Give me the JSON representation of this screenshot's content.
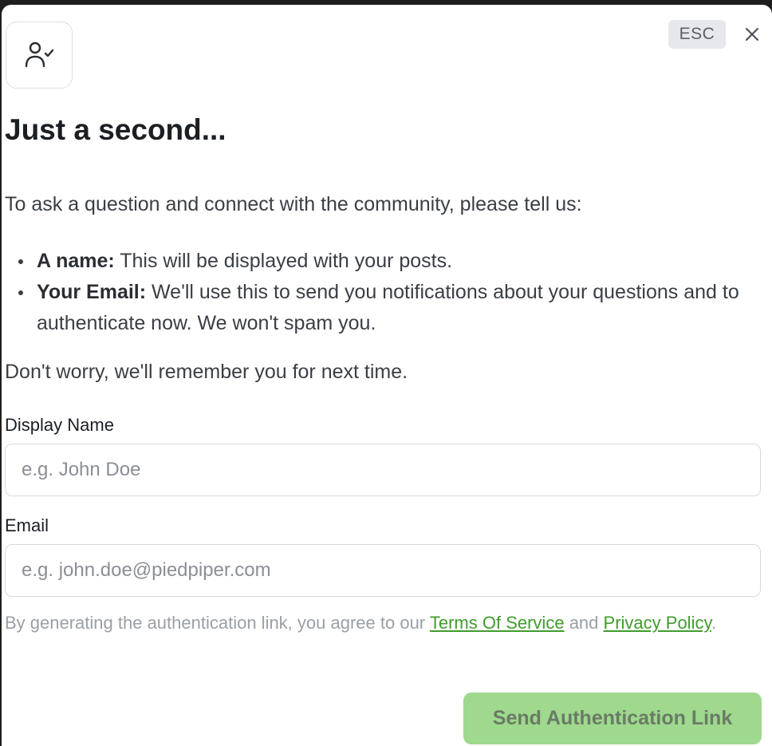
{
  "dialog": {
    "icon": "user-check-icon",
    "esc_label": "ESC",
    "close_icon": "close-icon",
    "title": "Just a second...",
    "intro": "To ask a question and connect with the community, please tell us:",
    "bullets": [
      {
        "label": "A name:",
        "text": "This will be displayed with your posts."
      },
      {
        "label": "Your Email:",
        "text": "We'll use this to send you notifications about your questions and to authenticate now. We won't spam you."
      }
    ],
    "reassurance": "Don't worry, we'll remember you for next time."
  },
  "form": {
    "name_label": "Display Name",
    "name_placeholder": "e.g. John Doe",
    "name_value": "",
    "email_label": "Email",
    "email_placeholder": "e.g. john.doe@piedpiper.com",
    "email_value": ""
  },
  "terms": {
    "prefix": "By generating the authentication link, you agree to our",
    "tos_link": "Terms Of Service",
    "and": "and",
    "privacy_link": "Privacy Policy",
    "suffix": "."
  },
  "submit": {
    "label": "Send Authentication Link"
  },
  "colors": {
    "accent": "#9ed98e",
    "link": "#3f9d2c"
  }
}
